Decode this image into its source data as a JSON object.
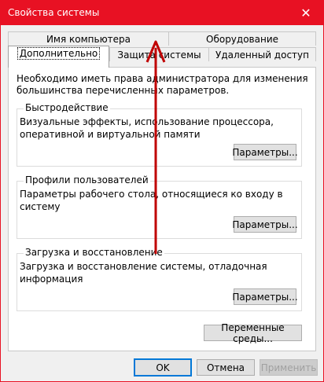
{
  "window": {
    "title": "Свойства системы",
    "close_label": "✕"
  },
  "tabs": {
    "row1": [
      "Имя компьютера",
      "Оборудование"
    ],
    "row2": [
      "Дополнительно",
      "Защита системы",
      "Удаленный доступ"
    ]
  },
  "panel": {
    "note": "Необходимо иметь права администратора для изменения большинства перечисленных параметров.",
    "performance": {
      "title": "Быстродействие",
      "description": "Визуальные эффекты, использование процессора, оперативной и виртуальной памяти",
      "button": "Параметры..."
    },
    "profiles": {
      "title": "Профили пользователей",
      "description": "Параметры рабочего стола, относящиеся ко входу в систему",
      "button": "Параметры..."
    },
    "startup": {
      "title": "Загрузка и восстановление",
      "description": "Загрузка и восстановление системы, отладочная информация",
      "button": "Параметры..."
    },
    "env_button": "Переменные среды..."
  },
  "footer": {
    "ok": "OK",
    "cancel": "Отмена",
    "apply": "Применить"
  },
  "colors": {
    "titlebar": "#e81123",
    "arrow": "#c00000",
    "default_button_border": "#0078d7"
  }
}
